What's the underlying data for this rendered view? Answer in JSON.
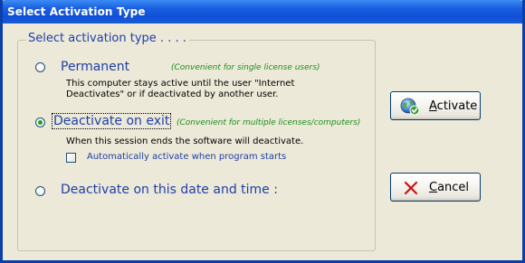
{
  "window": {
    "title": "Select Activation Type"
  },
  "group": {
    "legend": "Select activation type . . . ."
  },
  "options": {
    "permanent": {
      "label": "Permanent",
      "hint": "(Convenient for single license users)",
      "desc_line1": "This computer stays active until the user \"Internet",
      "desc_line2": "Deactivates\" or if deactivated by another user.",
      "selected": false
    },
    "deactivate_on_exit": {
      "label": "Deactivate on exit",
      "hint": "(Convenient for multiple licenses/computers)",
      "desc": "When this session ends the software will deactivate.",
      "selected": true
    },
    "deactivate_on_date": {
      "label": "Deactivate on this date and time :",
      "selected": false
    }
  },
  "auto_activate": {
    "label": "Automatically activate when program starts",
    "checked": false
  },
  "buttons": {
    "activate": {
      "mnemonic": "A",
      "rest": "ctivate",
      "icon": "globe-check-icon"
    },
    "cancel": {
      "mnemonic": "C",
      "rest": "ancel",
      "icon": "red-x-icon"
    }
  },
  "colors": {
    "titlebar": "#0f50d8",
    "dialog_bg": "#ece9d8",
    "label_blue": "#1f3fa8",
    "hint_green": "#1a8f1a",
    "radio_dot": "#21a121",
    "cancel_x": "#d01010"
  }
}
